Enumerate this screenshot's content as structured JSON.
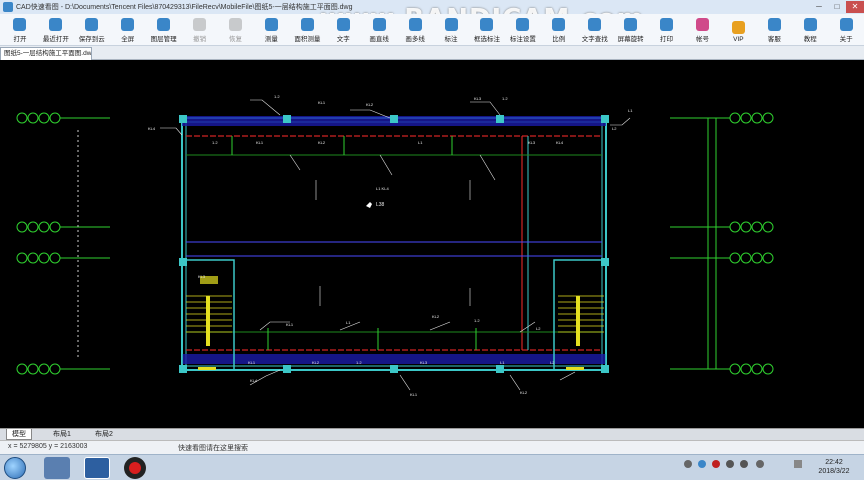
{
  "window": {
    "title": "CAD快速看图 - D:\\Documents\\Tencent Files\\870429313\\FileRecv\\MobileFile\\图纸5-一层结构施工平面图.dwg",
    "minimize": "─",
    "maximize": "□",
    "close": "✕"
  },
  "watermark": "www.BANDICAM.com",
  "toolbar": {
    "items": [
      {
        "label": "打开",
        "color": "#3a86c8",
        "disabled": false
      },
      {
        "label": "最近打开",
        "color": "#3a86c8",
        "disabled": false
      },
      {
        "label": "保存到云",
        "color": "#3a86c8",
        "disabled": false
      },
      {
        "label": "全屏",
        "color": "#3a86c8",
        "disabled": false
      },
      {
        "label": "图层管理",
        "color": "#3a86c8",
        "disabled": false
      },
      {
        "label": "撤销",
        "color": "#888888",
        "disabled": true
      },
      {
        "label": "恢复",
        "color": "#888888",
        "disabled": true
      },
      {
        "label": "测量",
        "color": "#3a86c8",
        "disabled": false
      },
      {
        "label": "面积测量",
        "color": "#3a86c8",
        "disabled": false
      },
      {
        "label": "文字",
        "color": "#3a86c8",
        "disabled": false
      },
      {
        "label": "画直线",
        "color": "#3a86c8",
        "disabled": false
      },
      {
        "label": "画多线",
        "color": "#3a86c8",
        "disabled": false
      },
      {
        "label": "标注",
        "color": "#3a86c8",
        "disabled": false
      },
      {
        "label": "框选标注",
        "color": "#3a86c8",
        "disabled": false
      },
      {
        "label": "标注设置",
        "color": "#3a86c8",
        "disabled": false
      },
      {
        "label": "比例",
        "color": "#3a86c8",
        "disabled": false
      },
      {
        "label": "文字查找",
        "color": "#3a86c8",
        "disabled": false
      },
      {
        "label": "屏幕旋转",
        "color": "#3a86c8",
        "disabled": false
      },
      {
        "label": "打印",
        "color": "#3a86c8",
        "disabled": false
      },
      {
        "label": "帐号",
        "color": "#d04a8a",
        "disabled": false
      },
      {
        "label": "VIP",
        "color": "#e8a020",
        "disabled": false
      },
      {
        "label": "客服",
        "color": "#3a86c8",
        "disabled": false
      },
      {
        "label": "教程",
        "color": "#3a86c8",
        "disabled": false
      },
      {
        "label": "关于",
        "color": "#3a86c8",
        "disabled": false
      }
    ]
  },
  "doc_tab": {
    "label": "图纸5-一层结构施工平面图.dwg ✕"
  },
  "layout_tabs": [
    {
      "label": "模型",
      "active": true
    },
    {
      "label": "布局1",
      "active": false
    },
    {
      "label": "布局2",
      "active": false
    }
  ],
  "status": {
    "coords": "x = 5279805  y = 2163003",
    "hint": "快速看图请在这里搜索"
  },
  "drawing": {
    "labels": [
      "1.2",
      "KL1",
      "KL2",
      "KL3",
      "KL4",
      "L1",
      "L2"
    ],
    "cursor_label": "L38"
  },
  "clock": {
    "time": "22:42",
    "date": "2018/3/22"
  },
  "colors": {
    "wall": "#3cc7c7",
    "beam": "#1e8a1e",
    "red_line": "#d02424",
    "blue_beam": "#1a1aa8",
    "dim_text": "#e8e8e8",
    "axis": "#2fd02f",
    "stair": "#e4e020"
  }
}
